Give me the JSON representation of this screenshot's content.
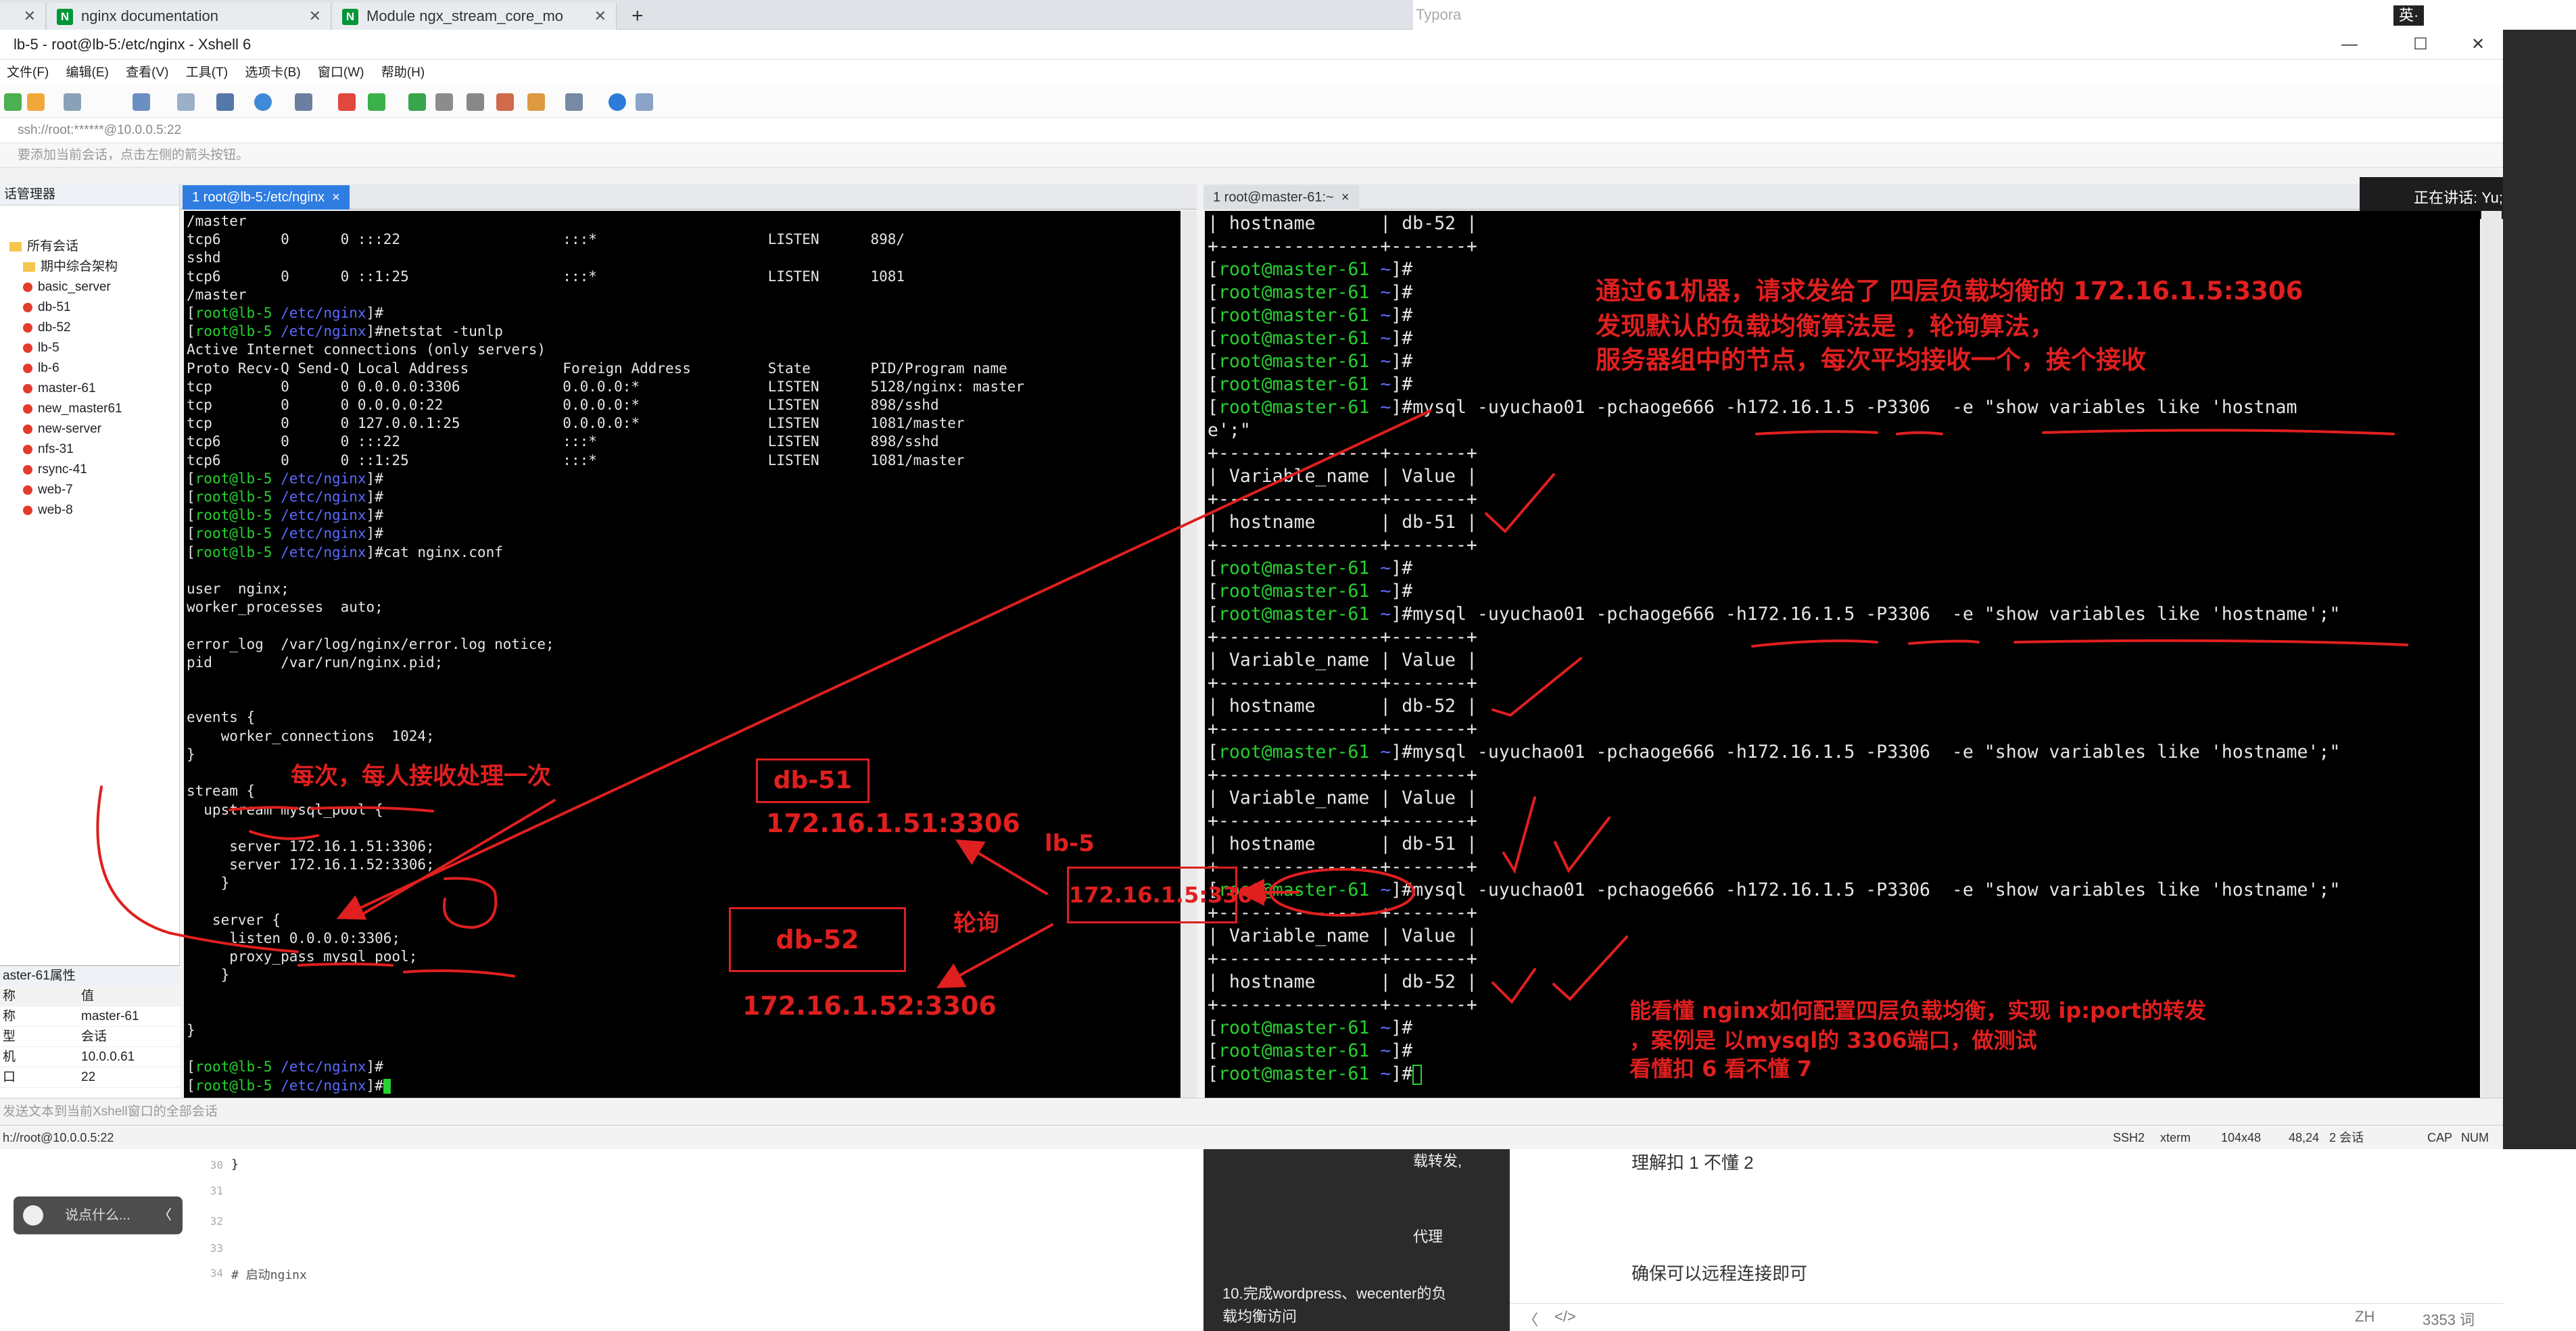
{
  "browser": {
    "tab1": "nginx documentation",
    "tab1_icon": "N",
    "tab2": "Module ngx_stream_core_mo",
    "tab2_icon": "N",
    "close": "✕",
    "new_tab": "+"
  },
  "typora": "Typora",
  "ime": "英·",
  "window": {
    "title": "lb-5 - root@lb-5:/etc/nginx - Xshell 6",
    "minimize": "—",
    "maximize": "☐",
    "close": "✕"
  },
  "menu": [
    "文件(F)",
    "编辑(E)",
    "查看(V)",
    "工具(T)",
    "选项卡(B)",
    "窗口(W)",
    "帮助(H)"
  ],
  "address": "ssh://root:******@10.0.0.5:22",
  "hint": "要添加当前会话，点击左侧的箭头按钮。",
  "session_manager": {
    "title": "话管理器",
    "root": "所有会话",
    "folder": "期中综合架构",
    "items": [
      "basic_server",
      "db-51",
      "db-52",
      "lb-5",
      "lb-6",
      "master-61",
      "new_master61",
      "new-server",
      "nfs-31",
      "rsync-41",
      "web-7",
      "web-8"
    ]
  },
  "properties": {
    "title": "aster-61属性",
    "col_name": "称",
    "col_value": "值",
    "rows": [
      {
        "k": "称",
        "v": "master-61"
      },
      {
        "k": "型",
        "v": "会话"
      },
      {
        "k": "机",
        "v": "10.0.0.61"
      },
      {
        "k": "口",
        "v": "22"
      }
    ]
  },
  "left_tab": "1 root@lb-5:/etc/nginx",
  "right_tab": "1 root@master-61:~",
  "speaking": "正在讲话: Yu;",
  "left_terminal": {
    "lines": [
      "/master",
      "tcp6       0      0 :::22                   :::*                    LISTEN      898/",
      "sshd",
      "tcp6       0      0 ::1:25                  :::*                    LISTEN      1081",
      "/master",
      "#netstat -tunlp",
      "Active Internet connections (only servers)",
      "Proto Recv-Q Send-Q Local Address           Foreign Address         State       PID/Program name",
      "tcp        0      0 0.0.0.0:3306            0.0.0.0:*               LISTEN      5128/nginx: master",
      "tcp        0      0 0.0.0.0:22              0.0.0.0:*               LISTEN      898/sshd",
      "tcp        0      0 127.0.0.1:25            0.0.0.0:*               LISTEN      1081/master",
      "tcp6       0      0 :::22                   :::*                    LISTEN      898/sshd",
      "tcp6       0      0 ::1:25                  :::*                    LISTEN      1081/master",
      "#cat nginx.conf",
      "user  nginx;",
      "worker_processes  auto;",
      "error_log  /var/log/nginx/error.log notice;",
      "pid        /var/run/nginx.pid;",
      "events {",
      "    worker_connections  1024;",
      "}",
      "stream {",
      "  upstream mysql_pool {",
      "     server 172.16.1.51:3306;",
      "     server 172.16.1.52:3306;",
      "    }",
      "   server {",
      "     listen 0.0.0.0:3306;",
      "     proxy_pass mysql_pool;",
      "    }",
      "}"
    ],
    "prompt_user": "root@lb-5",
    "prompt_path": "/etc/nginx"
  },
  "right_terminal": {
    "prompt_user": "root@master-61",
    "prompt_path": "~",
    "separator": "+---------------+-------+",
    "header": "| Variable_name | Value |",
    "row_hostname": "| hostname      |",
    "db51": "db-51 |",
    "db52": "db-52 |",
    "cmd_wrapped_1": "mysql -uyuchao01 -pchaoge666 -h172.16.1.5 -P3306  -e \"show variables like 'hostnam",
    "cmd_wrapped_2": "e';\"",
    "cmd": "mysql -uyuchao01 -pchaoge666 -h172.16.1.5 -P3306  -e \"show variables like 'hostname';\""
  },
  "annotations": {
    "top_line1": "通过61机器，请求发给了 四层负载均衡的 172.16.1.5:3306",
    "top_line2": "发现默认的负载均衡算法是 ，轮询算法，",
    "top_line3": "服务器组中的节点，每次平均接收一个，挨个接收",
    "each_time": "每次，每人接收处理一次",
    "db51_box": "db-51",
    "db51_addr": "172.16.1.51:3306",
    "db52_box": "db-52",
    "db52_addr": "172.16.1.52:3306",
    "lb5": "lb-5",
    "lb5_addr": "172.16.1.5:3306",
    "roundrobin": "轮询",
    "bottom_line1": "能看懂 nginx如何配置四层负载均衡，实现 ip:port的转发",
    "bottom_line2": "，案例是 以mysql的 3306端口，做测试",
    "bottom_line3": "看懂扣 6 看不懂 7"
  },
  "send_bar": "发送文本到当前Xshell窗口的全部会话",
  "status": {
    "left": "h://root@10.0.0.5:22",
    "proto": "SSH2",
    "term": "xterm",
    "size": "104x48",
    "pos": "48,24",
    "sessions": "2 会话",
    "cap": "CAP",
    "num": "NUM"
  },
  "editor": {
    "line30": "30",
    "line30_text": "}",
    "line31": "31",
    "line32": "32",
    "line33": "33",
    "line34": "34",
    "line34_text": "# 启动nginx",
    "chat": "说点什么...",
    "chat_arrow": "〈"
  },
  "dark_panel": {
    "t1": "载转发,",
    "t2": "代理",
    "t3": "10.完成wordpress、wecenter的负",
    "t4": "载均衡访问"
  },
  "right_doc": {
    "line1": "理解扣 1  不懂 2",
    "line2": "确保可以远程连接即可",
    "line3": "",
    "nav_back": "〈",
    "nav_code": "</>",
    "lang": "ZH",
    "words": "3353 词"
  }
}
